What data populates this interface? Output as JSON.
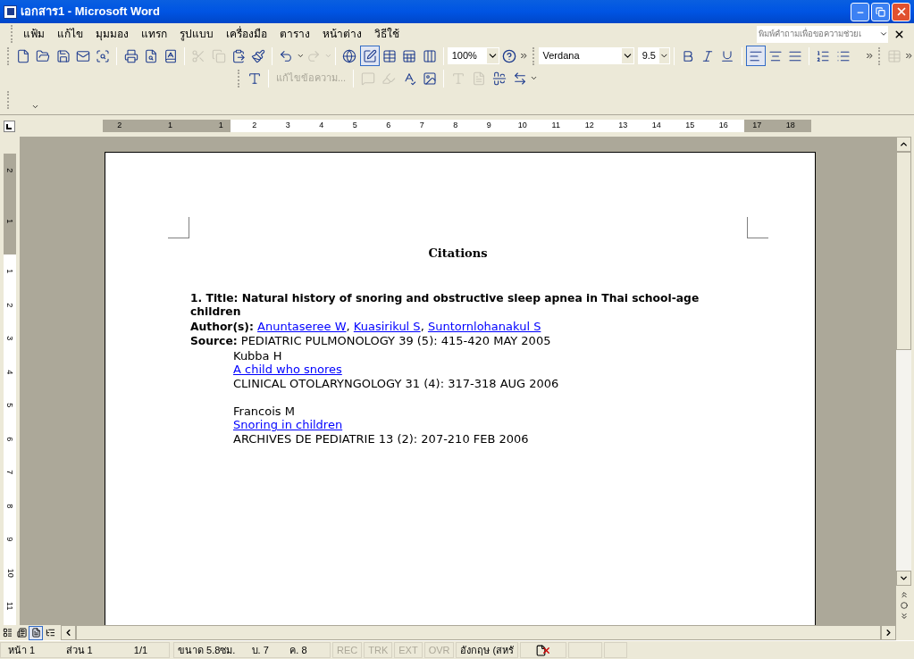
{
  "window": {
    "title": "เอกสาร1 - Microsoft Word"
  },
  "menu": [
    "แฟ้ม",
    "แก้ไข",
    "มุมมอง",
    "แทรก",
    "รูปแบบ",
    "เครื่องมือ",
    "ตาราง",
    "หน้าต่าง",
    "วิธีใช้"
  ],
  "help_box": {
    "placeholder": "พิมพ์คำถามเพื่อขอความช่วยเ"
  },
  "standard_toolbar": {
    "buttons": [
      {
        "disabled": false,
        "selected": false
      },
      {
        "disabled": false,
        "selected": false
      },
      {
        "disabled": false,
        "selected": false
      },
      {
        "disabled": false,
        "selected": false
      },
      {
        "disabled": false,
        "selected": false
      },
      {
        "disabled": false,
        "selected": false
      },
      {
        "disabled": false,
        "selected": false
      },
      {
        "disabled": false,
        "selected": false
      },
      {
        "disabled": true,
        "selected": false
      },
      {
        "disabled": true,
        "selected": false
      },
      {
        "disabled": false,
        "selected": false
      },
      {
        "disabled": false,
        "selected": false
      },
      {
        "disabled": false,
        "selected": false
      },
      {
        "disabled": true,
        "selected": false
      },
      {
        "disabled": false,
        "selected": false
      },
      {
        "disabled": false,
        "selected": true
      },
      {
        "disabled": false,
        "selected": false
      },
      {
        "disabled": false,
        "selected": false
      },
      {
        "disabled": false,
        "selected": false
      }
    ],
    "zoom": "100%"
  },
  "formatting_toolbar": {
    "font": "Verdana",
    "size": "9.5",
    "align": [
      {
        "selected": true
      },
      {
        "selected": false
      },
      {
        "selected": false
      }
    ]
  },
  "review_toolbar": {
    "edit_text": {
      "label": "แก้ไขข้อความ...",
      "disabled": true
    }
  },
  "ruler": {
    "labels": [
      "2",
      "1",
      "1",
      "2",
      "3",
      "4",
      "5",
      "6",
      "7",
      "8",
      "9",
      "10",
      "11",
      "12",
      "13",
      "14",
      "15",
      "16",
      "17",
      "18"
    ]
  },
  "vertical_ruler": {
    "labels": [
      "2",
      "1",
      "1",
      "2",
      "3",
      "4",
      "5",
      "6",
      "7",
      "8",
      "9",
      "10",
      "11"
    ]
  },
  "document": {
    "heading": "Citations",
    "first_entry": {
      "title": "1. Title: Natural history of snoring and obstructive sleep apnea in Thai school-age children",
      "authors_label": "Author(s):",
      "authors": [
        "Anuntaseree W",
        "Kuasirikul S",
        "Suntornlohanakul S"
      ],
      "separator": ",",
      "source_label": "Source:",
      "source": "PEDIATRIC PULMONOLOGY 39 (5): 415-420 MAY 2005"
    },
    "entries": [
      {
        "author": "Kubba H",
        "title": "A child who snores",
        "source": "CLINICAL OTOLARYNGOLOGY 31 (4): 317-318 AUG 2006"
      },
      {
        "author": "Francois M",
        "title": "Snoring in children",
        "source": "ARCHIVES DE PEDIATRIE 13 (2): 207-210 FEB 2006"
      }
    ]
  },
  "view_buttons": [
    {
      "selected": false
    },
    {
      "selected": false
    },
    {
      "selected": true
    },
    {
      "selected": false
    }
  ],
  "status_bar": {
    "fields": [
      "หน้า 1",
      "ส่วน 1",
      "1/1",
      "ขนาด 5.8ซม.",
      "บ. 7",
      "ค. 8"
    ],
    "modes": [
      {
        "label": "REC",
        "disabled": true
      },
      {
        "label": "TRK",
        "disabled": true
      },
      {
        "label": "EXT",
        "disabled": true
      },
      {
        "label": "OVR",
        "disabled": true
      }
    ],
    "language": "อังกฤษ (สหรั"
  }
}
